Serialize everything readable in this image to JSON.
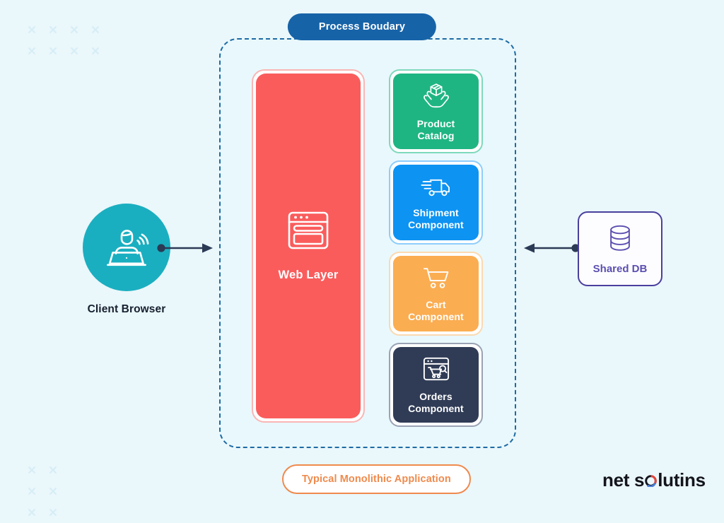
{
  "page": {
    "background": "#eaf7fb",
    "boundary_fill": "#e9f8fc"
  },
  "decorations": {
    "top_left_crosses": {
      "columns": 4,
      "rows": 2,
      "color": "#c7e6f3"
    },
    "bottom_left_crosses": {
      "columns": 2,
      "rows": 3,
      "color": "#c7e6f3"
    }
  },
  "client": {
    "label": "Client Browser",
    "icon": "person-laptop-wifi-icon",
    "circle_color": "#1aafc0"
  },
  "arrows": {
    "left": {
      "name": "arrow-client-to-boundary",
      "direction": "right",
      "color": "#2b3a55"
    },
    "right": {
      "name": "arrow-db-to-boundary",
      "direction": "left",
      "color": "#2b3a55"
    }
  },
  "boundary": {
    "badge_label": "Process Boudary",
    "badge_color": "#1763a8",
    "border_color": "#1d6ba4",
    "border_style": "dashed"
  },
  "web_layer": {
    "label": "Web Layer",
    "icon": "browser-window-icon",
    "fill": "#fa5c5c",
    "outline": "#fbb5b5"
  },
  "components": [
    {
      "label": "Product Catalog",
      "line1": "Product",
      "line2": "Catalog",
      "icon": "box-in-hands-icon",
      "fill": "#1fb583",
      "outline": "#7fd9bc"
    },
    {
      "label": "Shipment Component",
      "line1": "Shipment",
      "line2": "Component",
      "icon": "delivery-truck-icon",
      "fill": "#0d93f2",
      "outline": "#8ecdfb"
    },
    {
      "label": "Cart Component",
      "line1": "Cart",
      "line2": "Component",
      "icon": "shopping-cart-icon",
      "fill": "#fbad52",
      "outline": "#fbd9b0"
    },
    {
      "label": "Orders Component",
      "line1": "Orders",
      "line2": "Component",
      "icon": "browser-cart-icon",
      "fill": "#303c56",
      "outline": "#9aa3b4"
    }
  ],
  "shared_db": {
    "label": "Shared DB",
    "icon": "database-cylinder-icon",
    "border_color": "#4a3f9e",
    "text_color": "#5b4fb0"
  },
  "caption": {
    "text": "Typical Monolithic Application",
    "color": "#ef8a4d"
  },
  "brand": {
    "part1": "net s",
    "part2": "luti",
    "part3": "ns",
    "full": "net solutions",
    "color": "#14151c"
  }
}
